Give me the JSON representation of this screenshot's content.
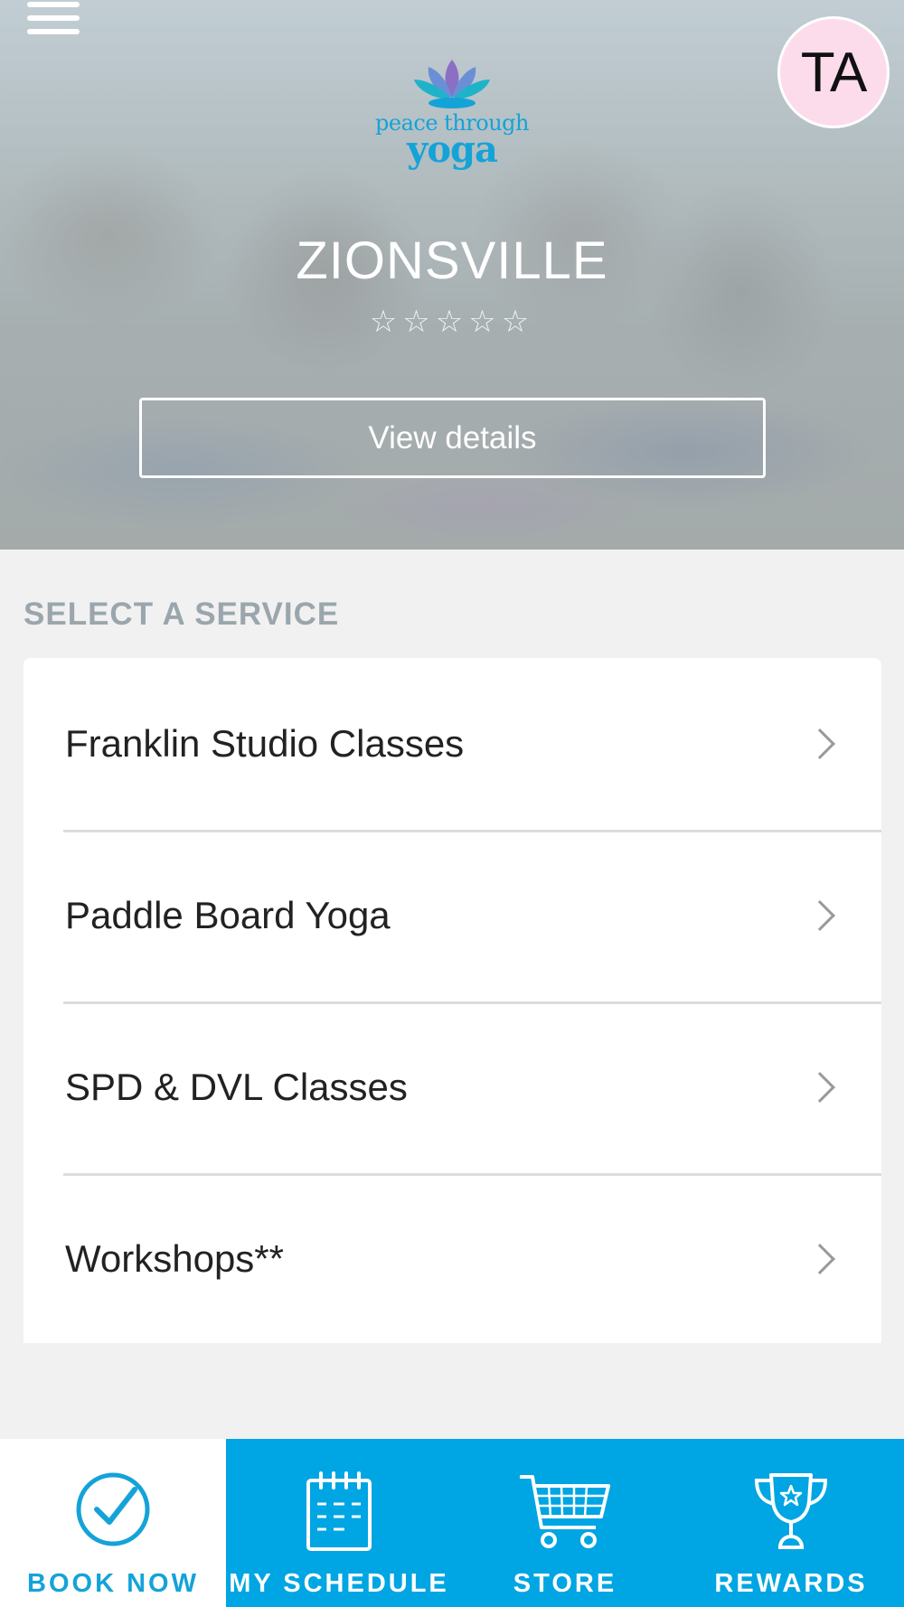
{
  "app": {
    "logo": {
      "line1": "peace through",
      "line2": "yoga"
    },
    "user_initials": "TA"
  },
  "header": {
    "location": "ZIONSVILLE",
    "rating_stars": "☆☆☆☆☆",
    "rating_value": 0,
    "rating_max": 5,
    "view_details_label": "View details"
  },
  "services": {
    "heading": "SELECT A SERVICE",
    "items": [
      {
        "label": "Franklin Studio Classes"
      },
      {
        "label": "Paddle Board Yoga"
      },
      {
        "label": "SPD & DVL Classes"
      },
      {
        "label": "Workshops**"
      }
    ]
  },
  "nav": {
    "tabs": [
      {
        "label": "BOOK NOW",
        "icon": "check-circle-icon",
        "active": true
      },
      {
        "label": "MY SCHEDULE",
        "icon": "calendar-icon",
        "active": false
      },
      {
        "label": "STORE",
        "icon": "cart-icon",
        "active": false
      },
      {
        "label": "REWARDS",
        "icon": "trophy-icon",
        "active": false
      }
    ]
  },
  "colors": {
    "accent": "#00a5e3",
    "avatar_bg": "#fcdcea",
    "section_heading": "#9aa6ac",
    "background": "#f1f1f1"
  }
}
